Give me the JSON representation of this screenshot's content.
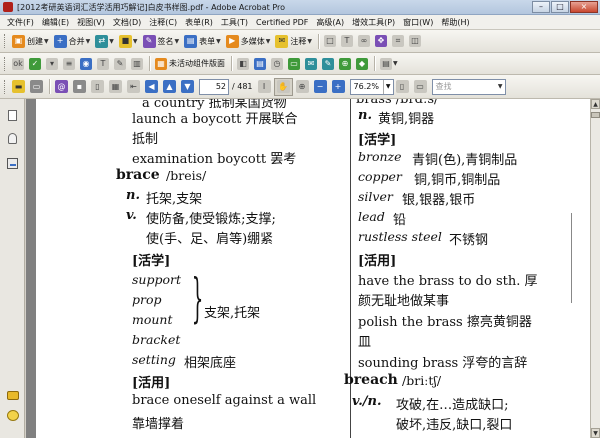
{
  "window": {
    "title": "[2012考研英语词汇活学活用巧解记]白皮书样图.pdf - Adobe Acrobat Pro",
    "minimize": "–",
    "maximize": "□",
    "close": "×"
  },
  "menu": [
    "文件(F)",
    "编辑(E)",
    "视图(V)",
    "文档(D)",
    "注释(C)",
    "表单(R)",
    "工具(T)",
    "Certified PDF",
    "高级(A)",
    "增效工具(P)",
    "窗口(W)",
    "帮助(H)"
  ],
  "toolbar1": {
    "create": "创建",
    "combine": "合并",
    "sign": "签名",
    "forms": "表单",
    "multimedia": "多媒体",
    "comment": "注释"
  },
  "toolbar2": {
    "unnamed_layout": "未活动组件版面"
  },
  "navigation": {
    "current_page": "52",
    "total_pages": "/ 481",
    "zoom": "76.2%",
    "find_placeholder": "查找"
  },
  "document": {
    "left_column": {
      "top_cut": "a country 抵制某国货物",
      "entry1_line1": "launch a boycott 开展联合",
      "entry1_line2": "抵制",
      "entry2": "examination boycott 罢考",
      "headword": "brace",
      "phonetic": "/breis/",
      "sense_n_pos": "n.",
      "sense_n": "托架,支架",
      "sense_v_pos": "v.",
      "sense_v_line1": "使防备,使受锻炼;支撑;",
      "sense_v_line2": "使(手、足、肩等)绷紧",
      "section_huoxue": "[活学]",
      "syn1": "support",
      "syn2": "prop",
      "syn3": "mount",
      "syn4": "bracket",
      "syn_gloss": "支架,托架",
      "setting_word": "setting",
      "setting_gloss": "相架底座",
      "section_huoyong": "[活用]",
      "phrase1": "brace oneself against a wall",
      "phrase1_gloss": "靠墙撑着"
    },
    "right_column": {
      "top_cut": "brass /brɑːs/",
      "sense_n_pos": "n.",
      "sense_n": "黄铜,铜器",
      "section_huoxue": "[活学]",
      "bronze": "bronze",
      "bronze_gloss": "青铜(色),青铜制品",
      "copper": "copper",
      "copper_gloss": "铜,铜币,铜制品",
      "silver": "silver",
      "silver_gloss": "银,银器,银币",
      "lead": "lead",
      "lead_gloss": "铅",
      "rustless": "rustless steel",
      "rustless_gloss": "不锈钢",
      "section_huoyong": "[活用]",
      "phrase1_line1": "have the brass to do sth. 厚",
      "phrase1_line2": "颜无耻地做某事",
      "phrase2_line1": "polish the brass 擦亮黄铜器",
      "phrase2_line2": "皿",
      "phrase3": "sounding brass 浮夸的言辞",
      "headword": "breach",
      "phonetic": "/briːtʃ/",
      "sense_pos": "v./n.",
      "sense_line1": "攻破,在…造成缺口;",
      "sense_line2": "破坏,违反,缺口,裂口"
    }
  }
}
